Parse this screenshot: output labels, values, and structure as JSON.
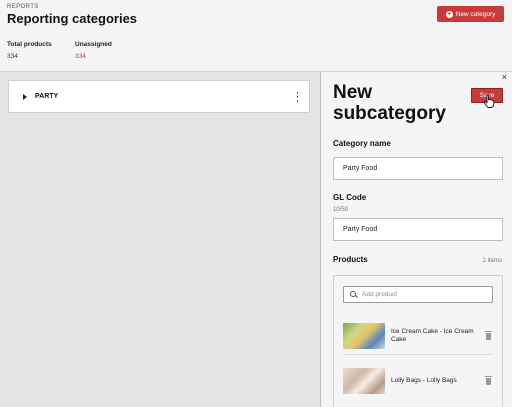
{
  "header": {
    "breadcrumb": "REPORTS",
    "title": "Reporting categories",
    "new_category_label": "New category"
  },
  "stats": {
    "total_products_label": "Total products",
    "total_products_value": "334",
    "unassigned_label": "Unassigned",
    "unassigned_value": "334"
  },
  "categories": [
    {
      "name": "PARTY"
    }
  ],
  "panel": {
    "close_symbol": "×",
    "title": "New subcategory",
    "save_label": "Save",
    "category_name_label": "Category name",
    "category_name_value": "Party Food",
    "gl_code_label": "GL Code",
    "gl_code_counter": "10/50",
    "gl_code_value": "Party Food",
    "products_label": "Products",
    "products_count": "2 items",
    "search_placeholder": "Add product",
    "products": [
      {
        "name": "Ice Cream Cake - Ice Cream Cake",
        "thumb": "cake"
      },
      {
        "name": "Lolly Bags - Lolly Bags",
        "thumb": "bags"
      }
    ]
  },
  "colors": {
    "accent": "#c93a3a",
    "panel_bg": "#f5f5f5",
    "page_bg": "#e4e4e4"
  },
  "icons": [
    "plus-icon",
    "caret-right-icon",
    "kebab-menu-icon",
    "close-icon",
    "cursor-hand-icon",
    "search-icon",
    "trash-icon"
  ]
}
